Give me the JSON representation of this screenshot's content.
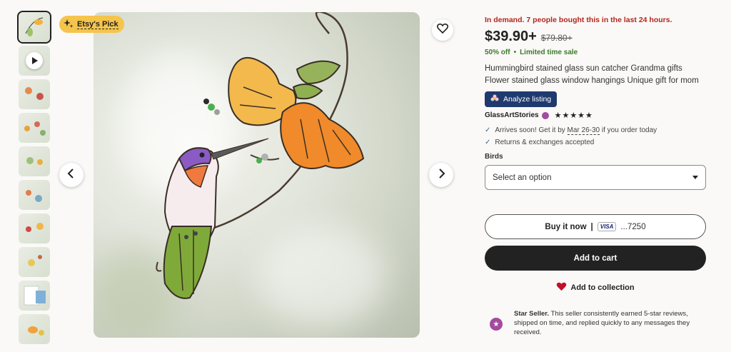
{
  "badge": {
    "label": "Etsy's Pick"
  },
  "thumbnails": [
    {
      "kind": "image"
    },
    {
      "kind": "video"
    },
    {
      "kind": "image"
    },
    {
      "kind": "image"
    },
    {
      "kind": "image"
    },
    {
      "kind": "image"
    },
    {
      "kind": "image"
    },
    {
      "kind": "image"
    },
    {
      "kind": "image"
    },
    {
      "kind": "image"
    }
  ],
  "product": {
    "demand": "In demand. 7 people bought this in the last 24 hours.",
    "price": "$39.90+",
    "old_price": "$79.80+",
    "discount": "50% off",
    "discount_sep": "•",
    "limited": "Limited time sale",
    "title": "Hummingbird stained glass sun catcher Grandma gifts Flower stained glass window hangings Unique gift for mom",
    "analyze_label": "Analyze listing",
    "seller": "GlassArtStories",
    "stars": "★★★★★",
    "arrives_pre": "Arrives soon! Get it by ",
    "arrives_date": "Mar 26-30",
    "arrives_post": " if you order today",
    "returns": "Returns & exchanges accepted",
    "variation_label": "Birds",
    "select_placeholder": "Select an option",
    "buy_now": "Buy it now",
    "buy_sep": "|",
    "card_brand": "VISA",
    "card_number": "...7250",
    "add_to_cart": "Add to cart",
    "add_collection": "Add to collection",
    "star_seller_title": "Star Seller.",
    "star_seller_text": " This seller consistently earned 5-star reviews, shipped on time, and replied quickly to any messages they received."
  },
  "colors": {
    "accent_red": "#b3261e",
    "green": "#3d7a2b",
    "dark": "#222222",
    "analyze_bg": "#1e3a6e",
    "star_seller": "#a44aa0",
    "badge": "#f5c44b"
  }
}
